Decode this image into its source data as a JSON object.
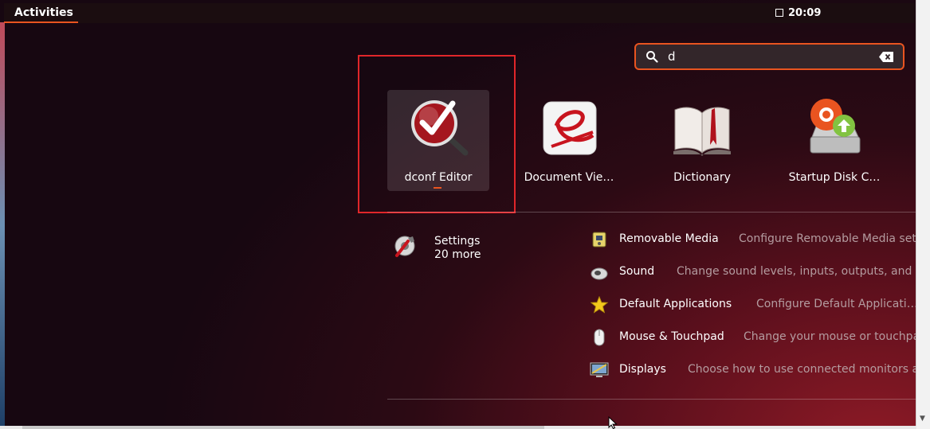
{
  "topbar": {
    "activities_label": "Activities",
    "clock": "20:09"
  },
  "search": {
    "value": "d",
    "search_icon": "search-icon",
    "clear_icon": "clear-icon"
  },
  "apps": [
    {
      "label": "dconf Editor",
      "icon": "dconf-editor-icon",
      "selected": true
    },
    {
      "label": "Document Vie…",
      "icon": "document-viewer-icon"
    },
    {
      "label": "Dictionary",
      "icon": "dictionary-icon"
    },
    {
      "label": "Startup Disk C…",
      "icon": "startup-disk-creator-icon"
    }
  ],
  "settings_provider": {
    "name": "Settings",
    "more": "20 more",
    "icon": "settings-icon"
  },
  "results": [
    {
      "name": "Removable Media",
      "desc": "Configure Removable Media setti",
      "icon": "removable-media-icon"
    },
    {
      "name": "Sound",
      "desc": "Change sound levels, inputs, outputs, and aler",
      "icon": "sound-icon"
    },
    {
      "name": "Default Applications",
      "desc": "Configure Default Applicati…",
      "icon": "default-applications-icon"
    },
    {
      "name": "Mouse & Touchpad",
      "desc": "Change your mouse or touchpad",
      "icon": "mouse-icon"
    },
    {
      "name": "Displays",
      "desc": "Choose how to use connected monitors and",
      "icon": "displays-icon"
    }
  ],
  "colors": {
    "accent": "#e95420",
    "highlight_frame": "#e0262a"
  }
}
